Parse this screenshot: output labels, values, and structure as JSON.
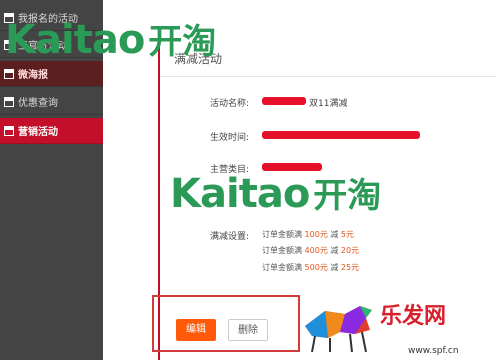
{
  "sidebar": {
    "items": [
      {
        "label": "我报名的活动"
      },
      {
        "label": "王官方活动"
      },
      {
        "label": "微海报"
      },
      {
        "label": "优惠查询"
      },
      {
        "label": "营销活动"
      }
    ]
  },
  "panel": {
    "title": "满减活动",
    "fields": [
      {
        "label": "活动名称:",
        "value": "双11满减"
      },
      {
        "label": "生效时间:",
        "value": ""
      },
      {
        "label": "主营类目:",
        "value": ""
      },
      {
        "label": "满减设置:",
        "value": ""
      }
    ],
    "rules": [
      {
        "prefix": "订单金额满",
        "amount": "100元",
        "mid": "减",
        "discount": "5元"
      },
      {
        "prefix": "订单金额满",
        "amount": "400元",
        "mid": "减",
        "discount": "20元"
      },
      {
        "prefix": "订单金额满",
        "amount": "500元",
        "mid": "减",
        "discount": "25元"
      }
    ],
    "actions": {
      "edit": "编辑",
      "delete": "删除"
    }
  },
  "watermarks": {
    "logo_en": "Kaitao",
    "logo_cn": "开淘",
    "brand_cn": "乐发网",
    "brand_url": "www.spf.cn"
  },
  "colors": {
    "accent": "#c40f2a",
    "orange": "#ff5a0a",
    "logo_green": "#2b9a57"
  }
}
